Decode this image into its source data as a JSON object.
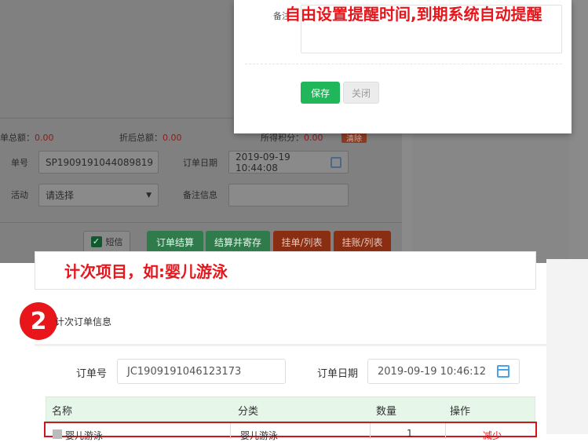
{
  "modal": {
    "remark_label": "备注",
    "annotation": "自由设置提醒时间,到期系统自动提醒",
    "save_label": "保存",
    "close_label": "关闭"
  },
  "order_panel": {
    "total_label": "单总额：",
    "total_value": "0.00",
    "discount_label": "折后总额：",
    "discount_value": "0.00",
    "points_label": "所得积分：",
    "points_value": "0.00",
    "clear_label": "清除",
    "order_no_label": "单号",
    "order_no_value": "SP1909191044089819",
    "order_date_label": "订单日期",
    "order_date_value": "2019-09-19 10:44:08",
    "activity_label": "活动",
    "activity_value": "请选择",
    "remark_label": "备注信息",
    "sms_label": "短信",
    "buttons": [
      "订单结算",
      "结算并寄存",
      "挂单/列表",
      "挂账/列表"
    ]
  },
  "annotation2": "计次项目，如:婴儿游泳",
  "section": {
    "step_number": "2",
    "title": "计次订单信息",
    "order_no_label": "订单号",
    "order_no_value": "JC1909191046123173",
    "order_date_label": "订单日期",
    "order_date_value": "2019-09-19 10:46:12"
  },
  "table": {
    "columns": [
      "名称",
      "分类",
      "数量",
      "操作"
    ],
    "rows": [
      {
        "name": "婴儿游泳",
        "category": "婴儿游泳",
        "qty": "1",
        "action": "减少"
      }
    ]
  },
  "colors": {
    "accent_red": "#e8151b",
    "save_green": "#1fb75a",
    "table_header": "#e6f7ea"
  }
}
